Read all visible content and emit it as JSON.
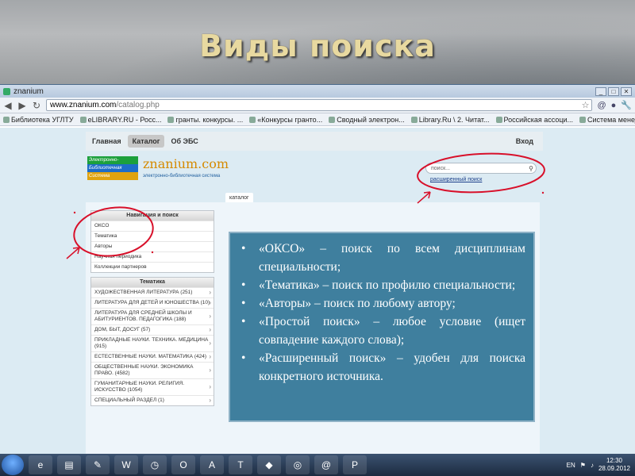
{
  "slide": {
    "title": "Виды поиска"
  },
  "browser": {
    "tab_title": "znanium",
    "url_domain": "www.znanium.com",
    "url_path": "/catalog.php",
    "bookmarks": [
      "Библиотека УГЛТУ",
      "eLIBRARY.RU - Росс...",
      "гранты. конкурсы. ...",
      "«Конкурсы гранто...",
      "Сводный электрон...",
      "Library.Ru \\ 2. Читат...",
      "Российская ассоци...",
      "Система менеджме..."
    ]
  },
  "site": {
    "nav": {
      "home": "Главная",
      "catalog": "Каталог",
      "about": "Об ЭБС",
      "login": "Вход"
    },
    "logo": {
      "line1": "Электронно-",
      "line2": "Библиотечная",
      "line3": "Система",
      "name": "znanium.com",
      "tagline": "электронно-библиотечная система"
    },
    "search": {
      "placeholder": "поиск...",
      "advanced_link": "расширенный поиск"
    },
    "catalog_tab": "каталог",
    "nav_panel": {
      "title": "Навигация и поиск",
      "items": [
        "ОКСО",
        "Тематика",
        "Авторы",
        "Научная периодика",
        "Коллекции партнеров"
      ]
    },
    "theme_panel": {
      "title": "Тематика",
      "items": [
        "ХУДОЖЕСТВЕННАЯ ЛИТЕРАТУРА (251)",
        "ЛИТЕРАТУРА ДЛЯ ДЕТЕЙ И ЮНОШЕСТВА (10)",
        "ЛИТЕРАТУРА ДЛЯ СРЕДНЕЙ ШКОЛЫ И АБИТУРИЕНТОВ. ПЕДАГОГИКА (188)",
        "ДОМ, БЫТ, ДОСУГ (57)",
        "ПРИКЛАДНЫЕ НАУКИ. ТЕХНИКА. МЕДИЦИНА (915)",
        "ЕСТЕСТВЕННЫЕ НАУКИ. МАТЕМАТИКА (424)",
        "ОБЩЕСТВЕННЫЕ НАУКИ. ЭКОНОМИКА ПРАВО. (4582)",
        "ГУМАНИТАРНЫЕ НАУКИ. РЕЛИГИЯ. ИСКУССТВО (1054)",
        "СПЕЦИАЛЬНЫЙ РАЗДЕЛ (1)"
      ]
    }
  },
  "info": {
    "items": [
      "«ОКСО» – поиск по всем дисциплинам специальности;",
      "«Тематика» – поиск по профилю специальности;",
      "«Авторы» – поиск по любому автору;",
      "«Простой поиск» – любое условие (ищет совпадение каждого слова);",
      "«Расширенный поиск» – удобен для поиска конкретного источника."
    ]
  },
  "taskbar": {
    "lang": "EN",
    "time": "12:30",
    "date": "28.09.2012"
  },
  "colors": {
    "title": "#e8d9a0",
    "info_bg": "#3f7f9e",
    "annotation": "#d8102a",
    "logo_orange": "#d58a00"
  }
}
